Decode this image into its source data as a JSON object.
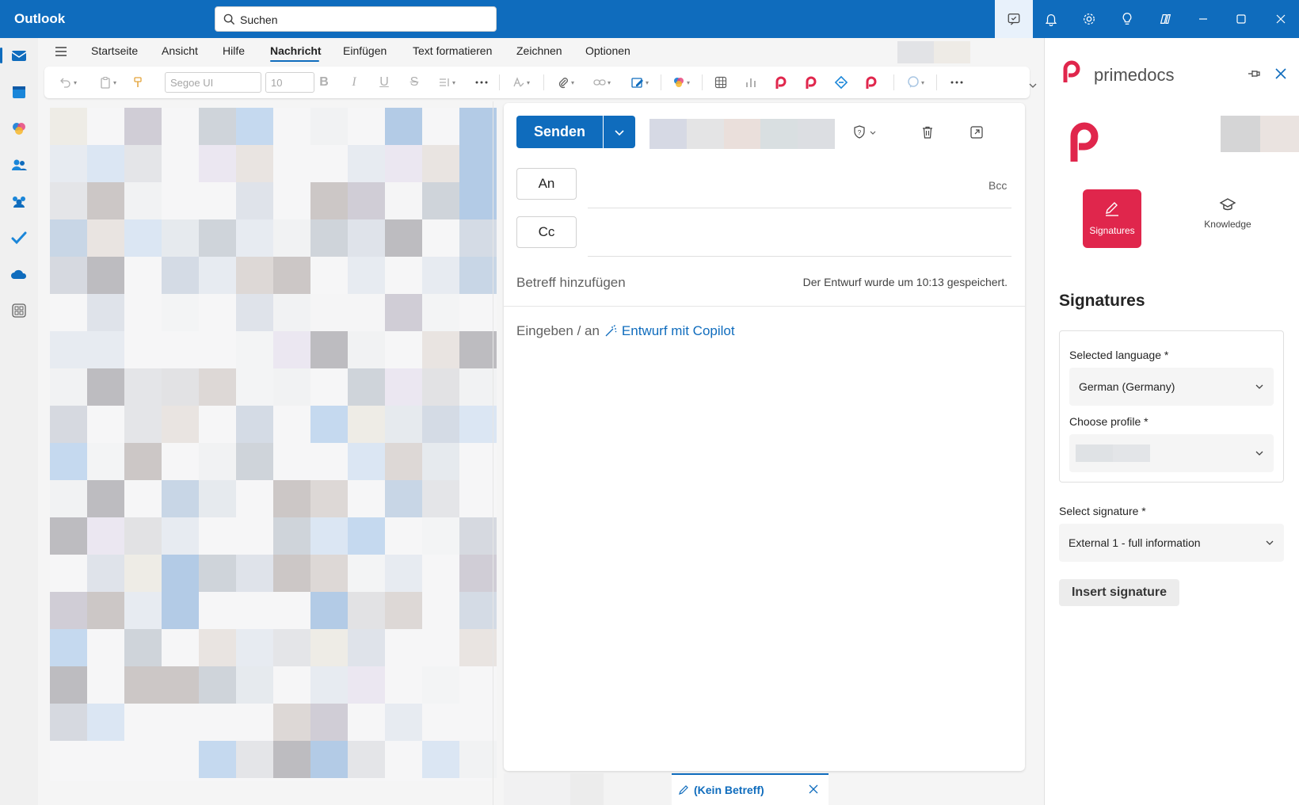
{
  "titlebar": {
    "app_title": "Outlook",
    "search_placeholder": "Suchen"
  },
  "ribbon": {
    "tabs": [
      "Startseite",
      "Ansicht",
      "Hilfe",
      "Nachricht",
      "Einfügen",
      "Text formatieren",
      "Zeichnen",
      "Optionen"
    ],
    "active_tab": "Nachricht",
    "font_name": "Segoe UI",
    "font_size": "10",
    "bold": "B",
    "italic": "I",
    "underline": "U",
    "strike": "S"
  },
  "compose": {
    "send_label": "Senden",
    "to_label": "An",
    "cc_label": "Cc",
    "bcc_label": "Bcc",
    "subject_placeholder": "Betreff hinzufügen",
    "draft_saved": "Der Entwurf wurde um 10:13 gespeichert.",
    "body_prefix": "Eingeben / an",
    "body_copilot": "Entwurf mit Copilot"
  },
  "bottom": {
    "draft_tab_label": "(Kein Betreff)"
  },
  "addin": {
    "brand": "primedocs",
    "nav": {
      "signatures": "Signatures",
      "knowledge": "Knowledge"
    },
    "heading": "Signatures",
    "language_label": "Selected language *",
    "language_value": "German (Germany)",
    "profile_label": "Choose profile *",
    "signature_label": "Select signature *",
    "signature_value": "External 1 - full information",
    "insert_button": "Insert signature"
  },
  "colors": {
    "accent": "#0f6cbd",
    "primedocs_red": "#e0264c"
  }
}
